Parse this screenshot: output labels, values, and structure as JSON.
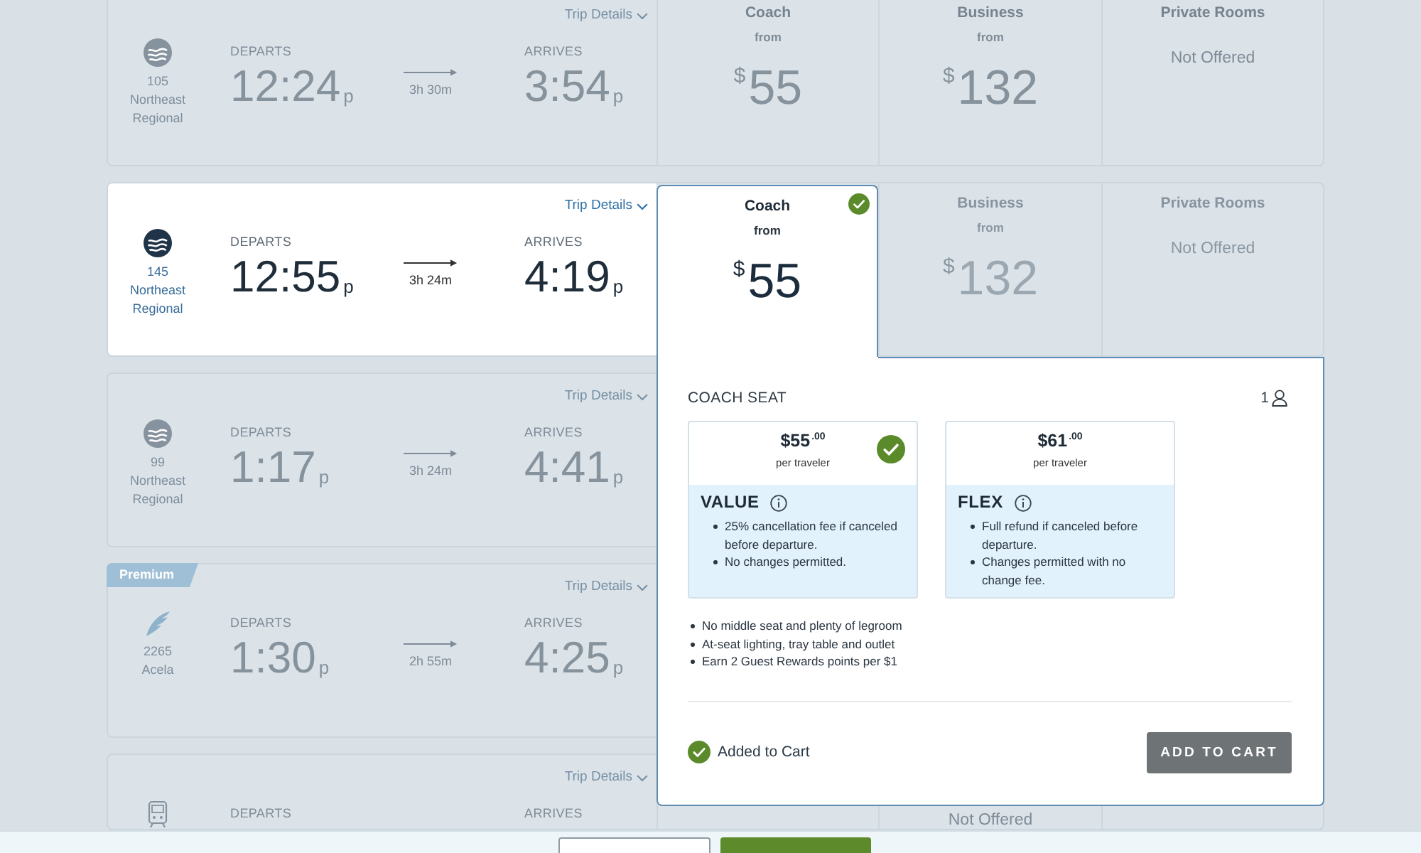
{
  "trips": [
    {
      "selected": false,
      "kind": "regional",
      "trip_details": "Trip Details",
      "train_number": "105",
      "train_name": "Northeast Regional",
      "departs_label": "DEPARTS",
      "departs": "12:24$_{p}$",
      "duration": "3h 30m",
      "arrives_label": "ARRIVES",
      "arrives": "3:54$_{p}$",
      "fares": [
        {
          "kind": "coach",
          "class": "Coach",
          "from": "from",
          "currency": "$",
          "amount": "55",
          "selected": false
        },
        {
          "kind": "business",
          "class": "Business",
          "from": "from",
          "currency": "$",
          "amount": "132",
          "selected": false
        },
        {
          "kind": "private_rooms",
          "class": "Private Rooms",
          "note": "Not Offered",
          "selected": false
        }
      ]
    },
    {
      "selected": true,
      "kind": "regional",
      "trip_details": "Trip Details",
      "train_number": "145",
      "train_name": "Northeast Regional",
      "departs_label": "DEPARTS",
      "departs": "12:55$_{p}$",
      "duration": "3h 24m",
      "arrives_label": "ARRIVES",
      "arrives": "4:19$_{p}$",
      "fares": [
        {
          "kind": "coach",
          "class": "Coach",
          "from": "from",
          "currency": "$",
          "amount": "55",
          "selected": true
        },
        {
          "kind": "business",
          "class": "Business",
          "from": "from",
          "currency": "$",
          "amount": "132",
          "selected": false
        },
        {
          "kind": "private_rooms",
          "class": "Private Rooms",
          "note": "Not Offered",
          "selected": false
        }
      ]
    },
    {
      "selected": false,
      "kind": "regional",
      "trip_details": "Trip Details",
      "train_number": "99",
      "train_name": "Northeast Regional",
      "departs_label": "DEPARTS",
      "departs": "1:17$_{p}$",
      "duration": "3h 24m",
      "arrives_label": "ARRIVES",
      "arrives": "4:41$_{p}$"
    },
    {
      "selected": false,
      "kind": "acela",
      "badge": "Premium",
      "trip_details": "Trip Details",
      "train_number": "2265",
      "train_name": "Acela",
      "departs_label": "DEPARTS",
      "departs": "1:30$_{p}$",
      "duration": "2h 55m",
      "arrives_label": "ARRIVES",
      "arrives": "4:25$_{p}$"
    },
    {
      "selected": false,
      "kind": "local",
      "trip_details": "Trip Details",
      "departs_label": "DEPARTS",
      "arrives_label": "ARRIVES",
      "fares": [
        {
          "kind": "business",
          "note": "Not Offered",
          "selected": false
        }
      ]
    }
  ],
  "fare_panel": {
    "title": "COACH SEAT",
    "travelers": "1",
    "options": [
      {
        "price": "$55$^{.00}$",
        "per": "per traveler",
        "name": "VALUE",
        "selected": true,
        "terms": [
          "25% cancellation fee if canceled before departure.",
          "No changes permitted."
        ]
      },
      {
        "price": "$61$^{.00}$",
        "per": "per traveler",
        "name": "FLEX",
        "selected": false,
        "terms": [
          "Full refund if canceled before departure.",
          "Changes permitted with no change fee."
        ]
      }
    ],
    "features": [
      "No middle seat and plenty of legroom",
      "At-seat lighting, tray table and outlet",
      "Earn 2 Guest Rewards points per $1"
    ],
    "status": "Added to Cart",
    "button": "ADD TO CART"
  },
  "bottom_bar": {
    "buttons": [
      {
        "kind": "secondary"
      },
      {
        "kind": "primary"
      }
    ]
  }
}
